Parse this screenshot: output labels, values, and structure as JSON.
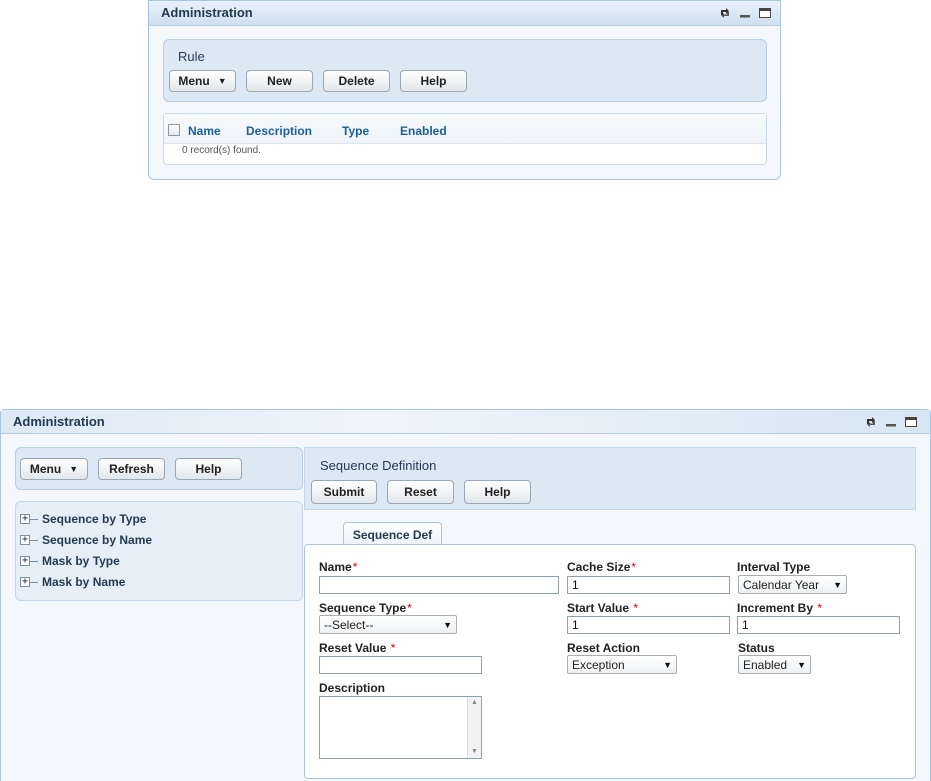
{
  "top_window": {
    "title": "Administration",
    "section_title": "Rule",
    "buttons": {
      "menu": "Menu",
      "new": "New",
      "delete": "Delete",
      "help": "Help"
    },
    "grid": {
      "columns": [
        "Name",
        "Description",
        "Type",
        "Enabled"
      ],
      "empty_text": "0 record(s) found."
    }
  },
  "bottom_window": {
    "title": "Administration",
    "left_toolbar": {
      "menu": "Menu",
      "refresh": "Refresh",
      "help": "Help"
    },
    "tree": [
      {
        "label": "Sequence by Type"
      },
      {
        "label": "Sequence by Name"
      },
      {
        "label": "Mask by Type"
      },
      {
        "label": "Mask by Name"
      }
    ],
    "form_header": {
      "title": "Sequence Definition",
      "submit": "Submit",
      "reset": "Reset",
      "help": "Help"
    },
    "tab_label": "Sequence Def",
    "fields": {
      "name": {
        "label": "Name",
        "value": ""
      },
      "cache_size": {
        "label": "Cache Size",
        "value": "1"
      },
      "interval_type": {
        "label": "Interval Type",
        "value": "Calendar Year"
      },
      "sequence_type": {
        "label": "Sequence Type",
        "value": "--Select--"
      },
      "start_value": {
        "label": "Start Value",
        "value": "1"
      },
      "increment_by": {
        "label": "Increment By",
        "value": "1"
      },
      "reset_value": {
        "label": "Reset Value",
        "value": ""
      },
      "reset_action": {
        "label": "Reset Action",
        "value": "Exception"
      },
      "status": {
        "label": "Status",
        "value": "Enabled"
      },
      "description": {
        "label": "Description",
        "value": ""
      }
    },
    "required_marker": "*"
  },
  "icons": {
    "window_controls": [
      "refresh-icon",
      "minimize-icon",
      "maximize-icon"
    ],
    "dropdown": "caret-down-icon",
    "tree_expand": "plus-box-icon"
  },
  "colors": {
    "header_text": "#233a52",
    "column_header": "#1d5d99",
    "required": "#dd0000",
    "panel_bg": "#dce8f4"
  }
}
